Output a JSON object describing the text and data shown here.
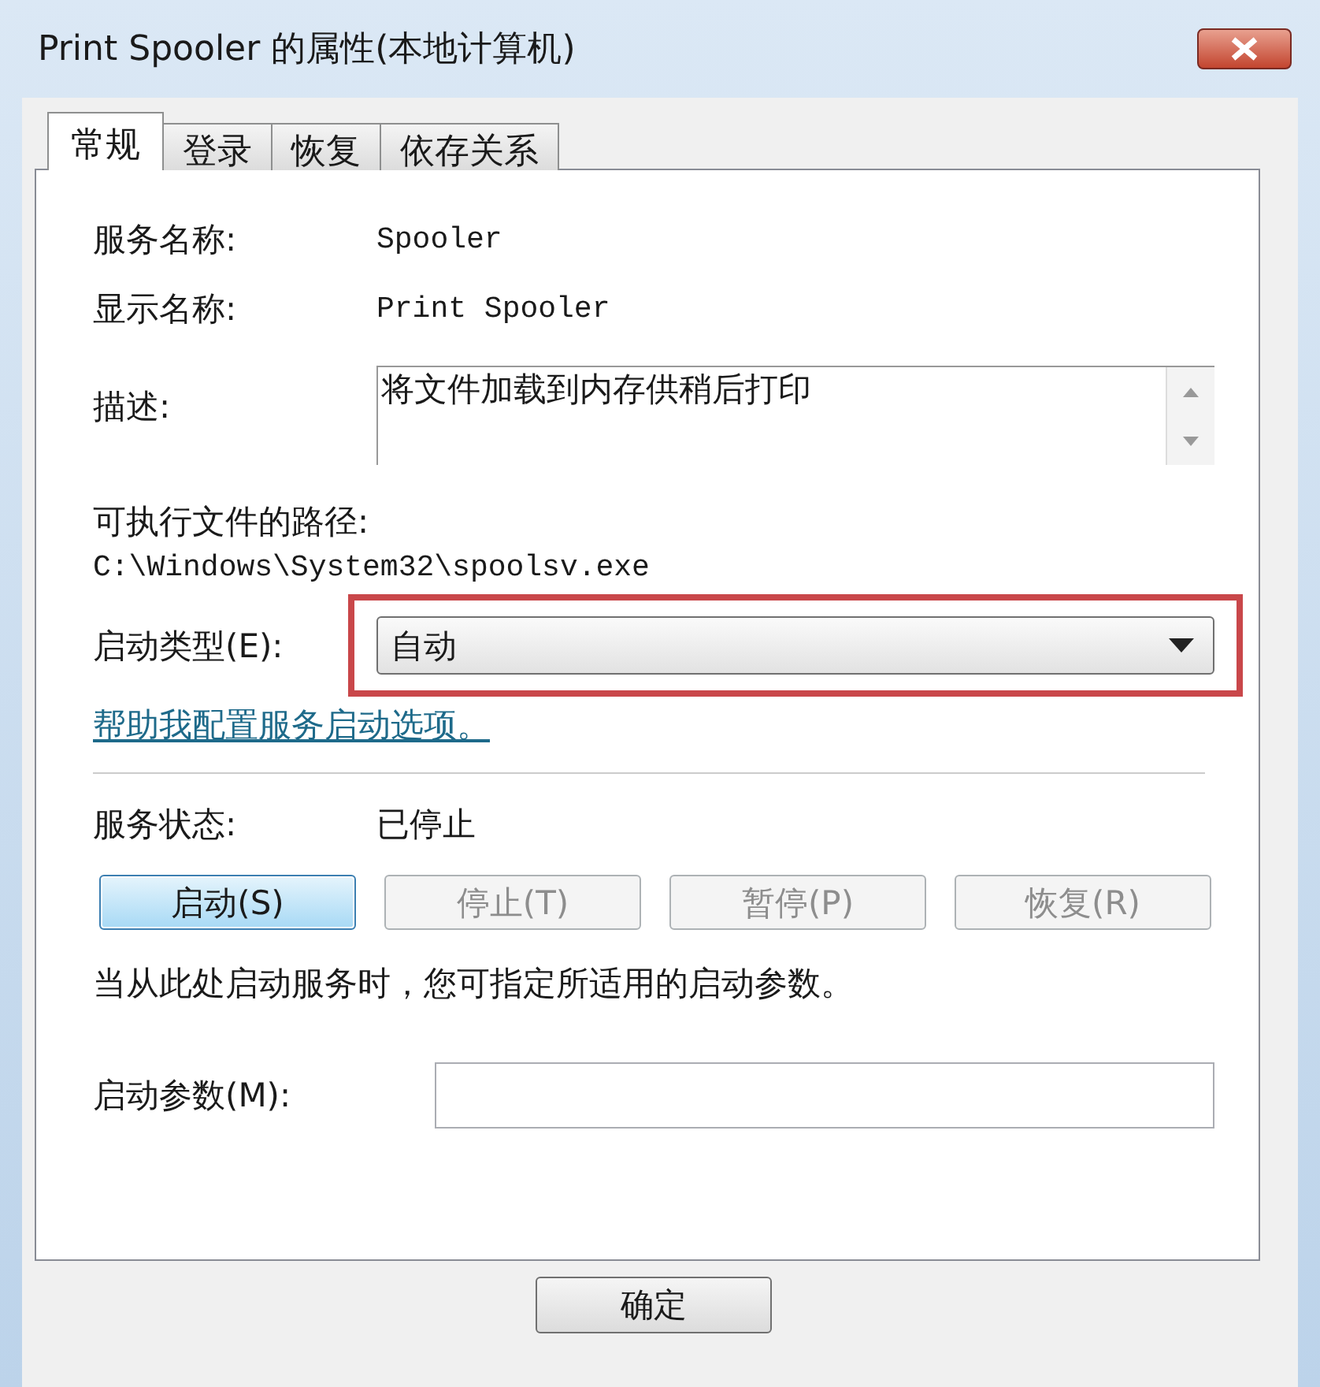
{
  "window": {
    "title": "Print Spooler 的属性(本地计算机)"
  },
  "tabs": [
    {
      "label": "常规",
      "selected": true
    },
    {
      "label": "登录",
      "selected": false
    },
    {
      "label": "恢复",
      "selected": false
    },
    {
      "label": "依存关系",
      "selected": false
    }
  ],
  "service_name": {
    "label": "服务名称:",
    "value": "Spooler"
  },
  "display_name": {
    "label": "显示名称:",
    "value": "Print Spooler"
  },
  "description": {
    "label": "描述:",
    "value": "将文件加载到内存供稍后打印"
  },
  "executable_path": {
    "label": "可执行文件的路径:",
    "value": "C:\\Windows\\System32\\spoolsv.exe"
  },
  "startup_type": {
    "label": "启动类型(E):",
    "value": "自动",
    "highlighted": true
  },
  "help_link": "帮助我配置服务启动选项。",
  "service_status": {
    "label": "服务状态:",
    "value": "已停止"
  },
  "service_buttons": [
    {
      "label": "启动(S)",
      "disabled": false
    },
    {
      "label": "停止(T)",
      "disabled": true
    },
    {
      "label": "暂停(P)",
      "disabled": true
    },
    {
      "label": "恢复(R)",
      "disabled": true
    }
  ],
  "note": "当从此处启动服务时，您可指定所适用的启动参数。",
  "start_parameters": {
    "label": "启动参数(M):"
  },
  "footer_buttons": [
    "确定"
  ]
}
